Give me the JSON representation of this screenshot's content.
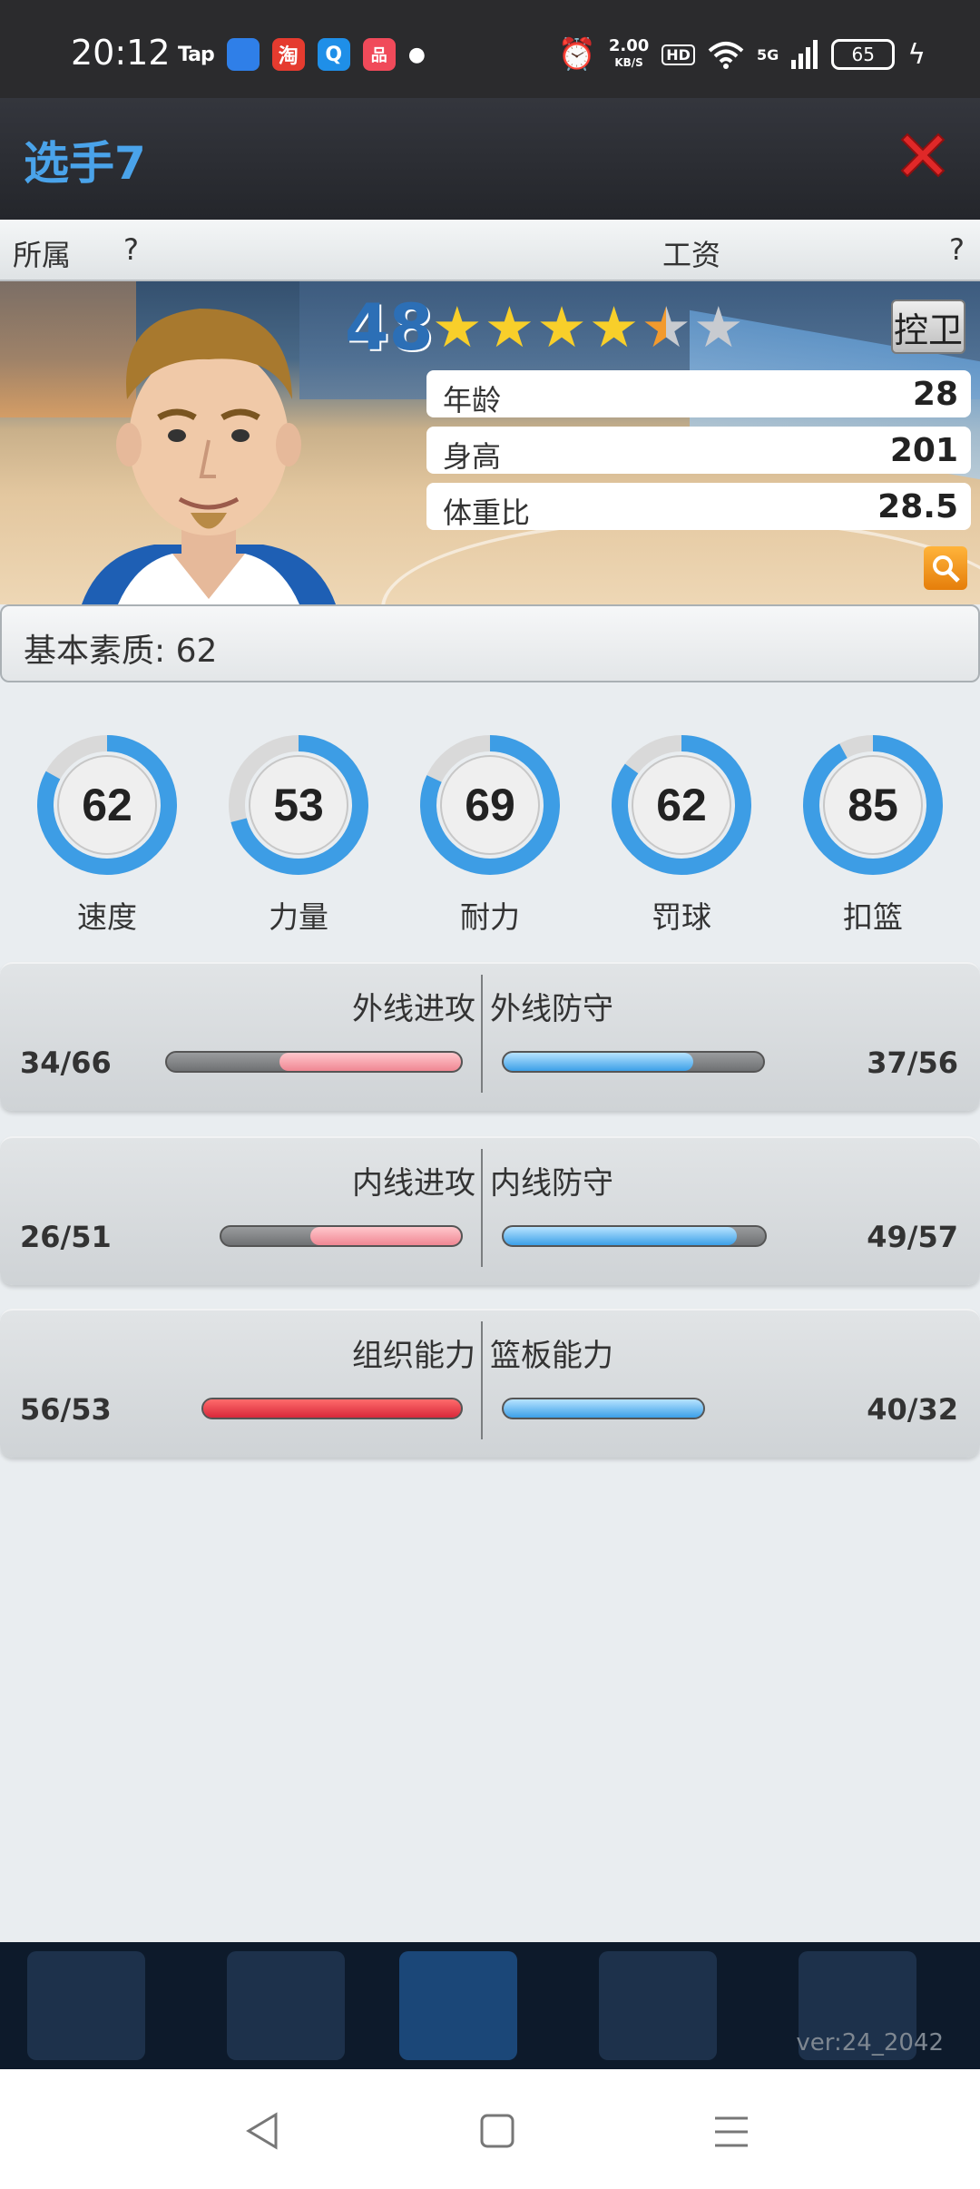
{
  "status_bar": {
    "time": "20:12",
    "apps": [
      "Tap",
      "淘",
      "Q",
      "品"
    ],
    "net_speed": "2.00",
    "net_unit": "KB/S",
    "hd": "HD",
    "signal": "5G",
    "battery": "65"
  },
  "header": {
    "title": "选手7"
  },
  "info": {
    "team_label": "所属",
    "team_value": "?",
    "salary_label": "工资",
    "salary_value": "?"
  },
  "player": {
    "rating": "48",
    "stars": 4.5,
    "position": "控卫",
    "stats": [
      {
        "label": "年龄",
        "value": "28"
      },
      {
        "label": "身高",
        "value": "201"
      },
      {
        "label": "体重比",
        "value": "28.5"
      }
    ]
  },
  "basic": {
    "label": "基本素质: 62"
  },
  "rings": [
    {
      "value": "62",
      "label": "速度",
      "fraction": 0.83
    },
    {
      "value": "53",
      "label": "力量",
      "fraction": 0.71
    },
    {
      "value": "69",
      "label": "耐力",
      "fraction": 0.82
    },
    {
      "value": "62",
      "label": "罚球",
      "fraction": 0.85
    },
    {
      "value": "85",
      "label": "扣篮",
      "fraction": 0.92
    }
  ],
  "pairs": [
    {
      "left_title": "外线进攻",
      "left_value": "34/66",
      "right_title": "外线防守",
      "right_value": "37/56",
      "left_fraction": 0.61,
      "right_fraction": 0.72
    },
    {
      "left_title": "内线进攻",
      "left_value": "26/51",
      "right_title": "内线防守",
      "right_value": "49/57",
      "left_fraction": 0.62,
      "right_fraction": 0.88
    },
    {
      "left_title": "组织能力",
      "left_value": "56/53",
      "right_title": "篮板能力",
      "right_value": "40/32",
      "left_fraction": 1.0,
      "right_fraction": 1.0
    }
  ],
  "game_nav": {
    "version": "ver:24_2042"
  },
  "colors": {
    "accent": "#4aa3ea",
    "ring": "#3d9de5",
    "red": "#d8283a",
    "blue": "#3ca0e8"
  }
}
